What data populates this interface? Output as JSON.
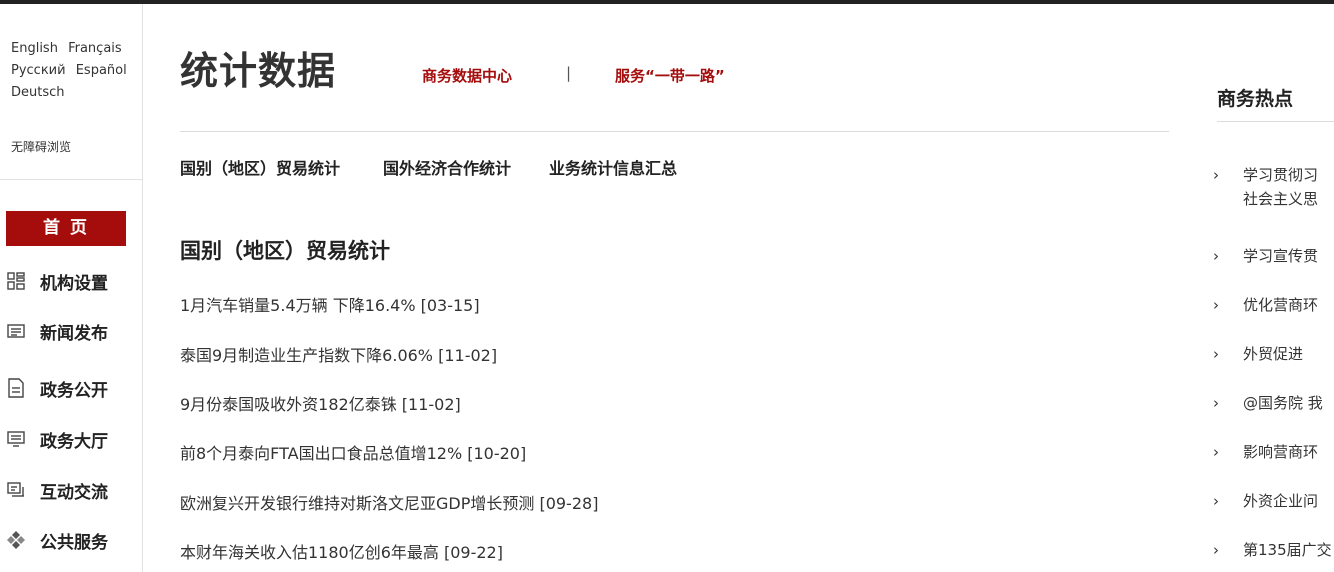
{
  "languages": {
    "row1": [
      "English",
      "Français"
    ],
    "row2": [
      "Русский",
      "Español"
    ],
    "row3": [
      "Deutsch"
    ],
    "accessible": "无障碍浏览"
  },
  "nav": {
    "home": "首 页",
    "items": [
      {
        "label": "机构设置",
        "icon": "org-grid-icon"
      },
      {
        "label": "新闻发布",
        "icon": "news-list-icon"
      },
      {
        "label": "政务公开",
        "icon": "document-icon"
      },
      {
        "label": "政务大厅",
        "icon": "hall-monitor-icon"
      },
      {
        "label": "互动交流",
        "icon": "chat-icon"
      },
      {
        "label": "公共服务",
        "icon": "service-diamond-icon"
      }
    ]
  },
  "header": {
    "title": "统计数据",
    "link1": "商务数据中心",
    "separator": "|",
    "link2": "服务“一带一路”"
  },
  "tabs": [
    "国别（地区）贸易统计",
    "国外经济合作统计",
    "业务统计信息汇总"
  ],
  "section": {
    "title": "国别（地区）贸易统计",
    "items": [
      "1月汽车销量5.4万辆 下降16.4% [03-15]",
      "泰国9月制造业生产指数下降6.06% [11-02]",
      "9月份泰国吸收外资182亿泰铢 [11-02]",
      "前8个月泰向FTA国出口食品总值增12% [10-20]",
      "欧洲复兴开发银行维持对斯洛文尼亚GDP增长预测 [09-28]",
      "本财年海关收入估1180亿创6年最高 [09-22]"
    ]
  },
  "hot": {
    "title": "商务热点",
    "chevron": "›",
    "items": [
      {
        "line1": "学习贯彻习",
        "line2": "社会主义思"
      },
      {
        "line1": "学习宣传贯"
      },
      {
        "line1": "优化营商环"
      },
      {
        "line1": "外贸促进"
      },
      {
        "line1": "@国务院 我"
      },
      {
        "line1": "影响营商环"
      },
      {
        "line1": "外资企业问"
      },
      {
        "line1": "第135届广交"
      }
    ]
  },
  "colors": {
    "accent": "#a50d0d",
    "text": "#333333",
    "divider": "#dcdcdc"
  }
}
